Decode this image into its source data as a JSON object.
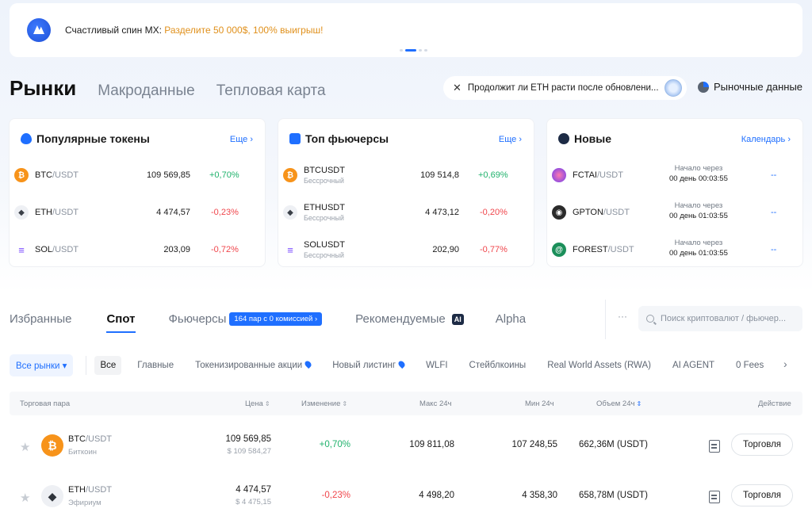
{
  "banner": {
    "text_main": "Счастливый спин MX: ",
    "text_highlight": "Разделите 50 000$, 100% выигрыш!"
  },
  "main_tabs": [
    {
      "label": "Рынки"
    },
    {
      "label": "Макроданные"
    },
    {
      "label": "Тепловая карта"
    }
  ],
  "news_pill": {
    "text": "Продолжит ли ETH расти после обновлени..."
  },
  "market_data_label": "Рыночные данные",
  "cards": {
    "popular": {
      "title": "Популярные токены",
      "more": "Еще",
      "rows": [
        {
          "base": "BTC",
          "quote": "/USDT",
          "price": "109 569,85",
          "change": "+0,70%",
          "dir": "up"
        },
        {
          "base": "ETH",
          "quote": "/USDT",
          "price": "4 474,57",
          "change": "-0,23%",
          "dir": "down"
        },
        {
          "base": "SOL",
          "quote": "/USDT",
          "price": "203,09",
          "change": "-0,72%",
          "dir": "down"
        }
      ]
    },
    "futures": {
      "title": "Топ фьючерсы",
      "more": "Еще",
      "rows": [
        {
          "pair": "BTCUSDT",
          "sub": "Бессрочный",
          "price": "109 514,8",
          "change": "+0,69%",
          "dir": "up"
        },
        {
          "pair": "ETHUSDT",
          "sub": "Бессрочный",
          "price": "4 473,12",
          "change": "-0,20%",
          "dir": "down"
        },
        {
          "pair": "SOLUSDT",
          "sub": "Бессрочный",
          "price": "202,90",
          "change": "-0,77%",
          "dir": "down"
        }
      ]
    },
    "new": {
      "title": "Новые",
      "more": "Календарь",
      "rows": [
        {
          "base": "FCTAI",
          "quote": "/USDT",
          "start_label": "Начало через",
          "start_time": "00 день 00:03:55",
          "value": "--"
        },
        {
          "base": "GPTON",
          "quote": "/USDT",
          "start_label": "Начало через",
          "start_time": "00 день 01:03:55",
          "value": "--"
        },
        {
          "base": "FOREST",
          "quote": "/USDT",
          "start_label": "Начало через",
          "start_time": "00 день 01:03:55",
          "value": "--"
        }
      ]
    }
  },
  "section_tabs": {
    "favorites": "Избранные",
    "spot": "Спот",
    "futures": "Фьючерсы",
    "promo_badge": "164 пар с 0 комиссией ›",
    "recommended": "Рекомендуемые",
    "ai_badge": "AI",
    "alpha": "Alpha"
  },
  "more_dots": "···",
  "search": {
    "placeholder": "Поиск криптовалют / фьючер..."
  },
  "filters": {
    "all_markets": "Все рынки",
    "items": [
      "Все",
      "Главные",
      "Токенизированные акции",
      "Новый листинг",
      "WLFI",
      "Стейблкоины",
      "Real World Assets (RWA)",
      "AI AGENT",
      "0 Fees"
    ]
  },
  "table": {
    "headers": {
      "pair": "Торговая пара",
      "price": "Цена",
      "change": "Изменение",
      "high": "Макс 24ч",
      "low": "Мин 24ч",
      "volume": "Объем 24ч",
      "action": "Действие"
    },
    "rows": [
      {
        "base": "BTC",
        "quote": "/USDT",
        "name": "Биткоин",
        "price": "109 569,85",
        "price_usd": "$ 109 584,27",
        "change": "+0,70%",
        "dir": "up",
        "high": "109 811,08",
        "low": "107 248,55",
        "volume": "662,36M (USDT)",
        "action": "Торговля"
      },
      {
        "base": "ETH",
        "quote": "/USDT",
        "name": "Эфириум",
        "price": "4 474,57",
        "price_usd": "$ 4 475,15",
        "change": "-0,23%",
        "dir": "down",
        "high": "4 498,20",
        "low": "4 358,30",
        "volume": "658,78M (USDT)",
        "action": "Торговля"
      }
    ]
  },
  "colors": {
    "accent": "#1f6fff",
    "up": "#20b26c",
    "down": "#f0464c",
    "btc": "#f7931a"
  }
}
